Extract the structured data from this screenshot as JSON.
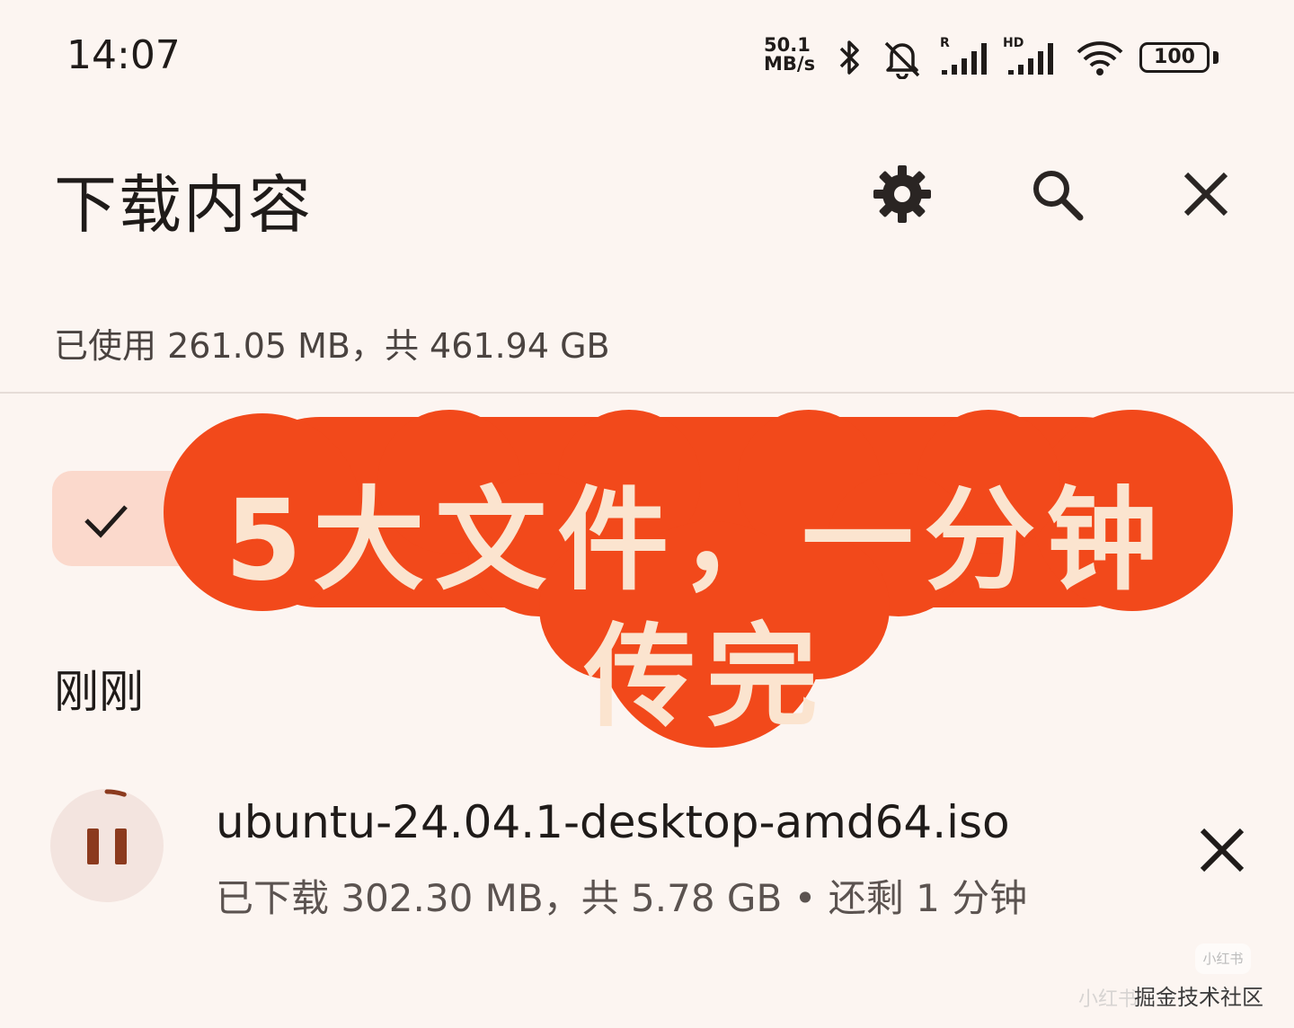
{
  "status_bar": {
    "time": "14:07",
    "net_speed_value": "50.1",
    "net_speed_unit": "MB/s",
    "signal1_label": "R",
    "signal2_label": "HD",
    "battery": "100",
    "icons": [
      "bluetooth-icon",
      "silent-bell-icon",
      "signal-icon",
      "signal-icon",
      "wifi-icon",
      "battery-icon"
    ]
  },
  "header": {
    "title": "下载内容",
    "actions": [
      "settings-icon",
      "search-icon",
      "close-icon"
    ]
  },
  "storage": {
    "summary": "已使用 261.05 MB，共 461.94 GB"
  },
  "section": {
    "heading": "刚刚"
  },
  "download": {
    "file_name": "ubuntu-24.04.1-desktop-amd64.iso",
    "status": "已下载 302.30 MB，共 5.78 GB • 还剩 1 分钟",
    "progress_fraction": 0.052,
    "accent": "#8b3a1e"
  },
  "promo": {
    "line1": "5大文件，一分钟",
    "line2": "传完",
    "color": "#f2491b"
  },
  "watermark": {
    "badge": "小红书",
    "faint": "小红书",
    "text": "掘金技术社区"
  }
}
